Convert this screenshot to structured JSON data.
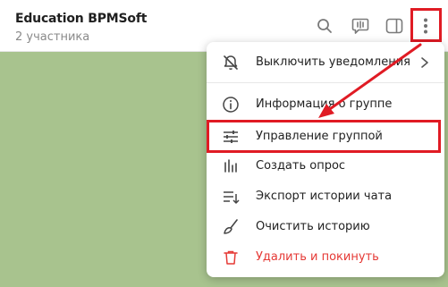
{
  "header": {
    "title": "Education BPMSoft",
    "subtitle": "2 участника",
    "icons": [
      "search-icon",
      "video-chat-icon",
      "sidebar-toggle-icon",
      "more-vertical-icon"
    ]
  },
  "menu": {
    "items": [
      {
        "label": "Выключить уведомления",
        "icon": "bell-mute-icon",
        "has_submenu": true
      },
      {
        "label": "Информация о группе",
        "icon": "info-icon"
      },
      {
        "label": "Управление группой",
        "icon": "sliders-icon"
      },
      {
        "label": "Создать опрос",
        "icon": "poll-icon"
      },
      {
        "label": "Экспорт истории чата",
        "icon": "export-icon"
      },
      {
        "label": "Очистить историю",
        "icon": "broom-icon"
      },
      {
        "label": "Удалить и покинуть",
        "icon": "trash-icon",
        "danger": true
      }
    ]
  },
  "colors": {
    "chat_background": "#a8c38e",
    "highlight": "#e01b24",
    "danger": "#e53935"
  }
}
